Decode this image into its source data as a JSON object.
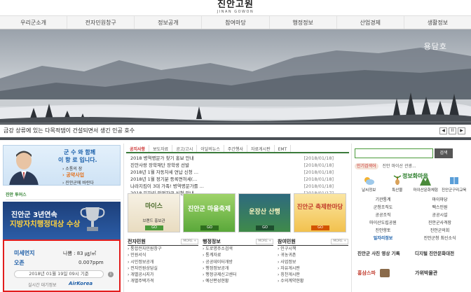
{
  "header": {
    "logo_ko": "진안고원",
    "logo_en": "JINAN GOWON"
  },
  "gnb": [
    "우리군소개",
    "전자민원창구",
    "정보공개",
    "참여마당",
    "행정정보",
    "산업경제",
    "생활정보"
  ],
  "hero": {
    "place": "용담호",
    "caption": "금강 상류에 있는 다목적댐이 건설되면서 생긴 인공 호수",
    "prev": "◀",
    "pause": "II",
    "next": "▶"
  },
  "governor": {
    "title": "군 수 와 함께",
    "line1": "이 항 로 입니다.",
    "line2": "› 소통의 장",
    "line3": "› 공약사업",
    "line4": "› 진안군에 바란다"
  },
  "tours": {
    "small": "진안 투어스",
    "big": "투어스"
  },
  "award": {
    "line1": "진안군 3년연속",
    "line2": "지방자치행정대상 수상"
  },
  "air": {
    "pm_label": "미세먼지",
    "pm_value": "나쁨 : 83 ㎍/㎥",
    "ozone_label": "오존",
    "ozone_value": "0.007ppm",
    "date": "2018년 01월 19일 09시 기준",
    "info": "i",
    "source": "실시간 대기정보",
    "source_logo": "AirKorea"
  },
  "news_tabs": [
    "공지사항",
    "보도자료",
    "공고/고시",
    "이달의뉴스",
    "주간행사",
    "자료게시판",
    "EMT"
  ],
  "news": [
    {
      "title": "2018 병역명문가 찾기 홍보 안내",
      "date": "[2018/01/18]"
    },
    {
      "title": "진안사랑 장학재단 장학생 선발",
      "date": "[2018/01/18]"
    },
    {
      "title": "2018년 1월 자동차세 연납 신청 ...",
      "date": "[2018/01/18]"
    },
    {
      "title": "2018년 1월 정기분 등록면허세(...",
      "date": "[2018/01/18]"
    },
    {
      "title": "나라지킴이 3대 가족! 병역명문가를 ...",
      "date": "[2018/01/18]"
    },
    {
      "title": "2018 일자리 안정자금 신청 안내 ...",
      "date": "[2018/01/17]"
    }
  ],
  "tiles": [
    {
      "title": "마이스",
      "sub": "브랜드 홍보관",
      "go": "GO"
    },
    {
      "title": "진안군 마을축제",
      "sub": "",
      "go": "GO"
    },
    {
      "title": "운장산 산행",
      "sub": "",
      "go": "GO"
    },
    {
      "title": "진안군 축제한마당",
      "sub": "",
      "go": "GO"
    }
  ],
  "sections": [
    {
      "title": "전자민원",
      "more": "MORE +",
      "items": [
        "› 통합전자민원창구",
        "› 민원서식",
        "› 시민정보공개",
        "› 전자민원상담실",
        "› 개별공시지가",
        "› 개별주택가격"
      ]
    },
    {
      "title": "행정정보",
      "more": "MORE +",
      "items": [
        "› 도로명주소검색",
        "› 통계자료",
        "› 공공데이터개방",
        "› 행정정보공개",
        "› 행정규제신고센터",
        "› 예산편성현황"
      ]
    },
    {
      "title": "참여민원",
      "more": "MORE +",
      "items": [
        "› 인구시책",
        "› 귀농귀촌",
        "› 사업정보",
        "› 자유게시판",
        "› 칭찬게시판",
        "› 수의계약현황"
      ]
    }
  ],
  "search": {
    "placeholder": "",
    "button": "검색"
  },
  "keywords": {
    "badge": "인기검색어",
    "text": "진안 마이산 관광..."
  },
  "quick": [
    {
      "label": "날씨정보"
    },
    {
      "label": "특산물"
    },
    {
      "label": "마이산문화체험"
    },
    {
      "label": "진안군구리교육"
    }
  ],
  "brand_box": "정보화마을",
  "links": [
    [
      "기관통계",
      "마이마당"
    ],
    [
      "군청조직도",
      "팩스민원"
    ],
    [
      "공공조직",
      "공공시설"
    ],
    [
      "마이산도립공원",
      "진안군사격장"
    ],
    [
      "진안향토",
      "진안군의회"
    ],
    [
      "일자리정보",
      "진안군청 최신소식"
    ]
  ],
  "rboxes": [
    {
      "label": "진안군 사진 영상 기록"
    },
    {
      "label": "디지털 진안문화대전"
    },
    {
      "label": "홍삼스파"
    },
    {
      "label": "가위박물관"
    }
  ]
}
